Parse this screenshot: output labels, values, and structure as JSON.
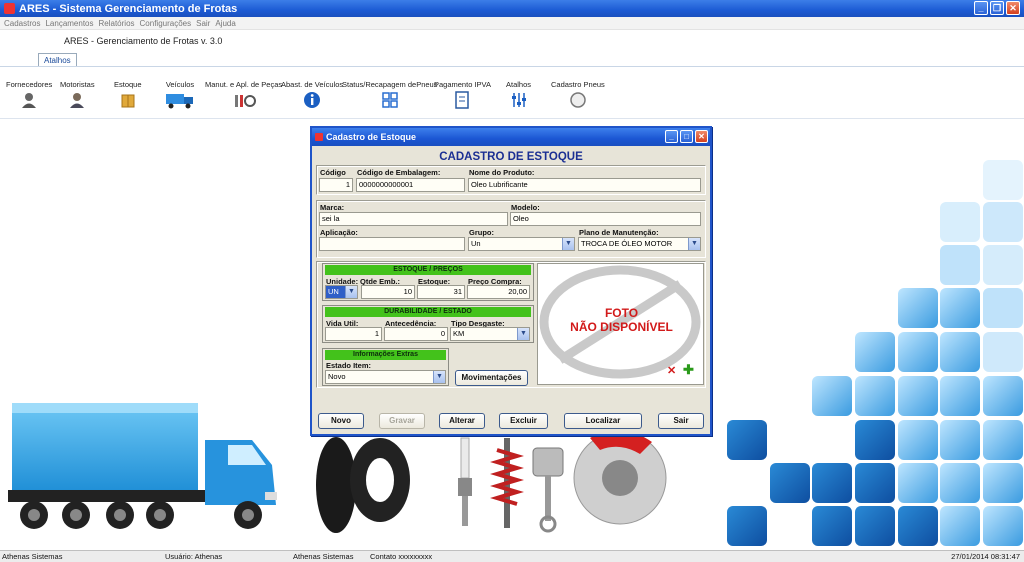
{
  "window": {
    "title": "ARES - Sistema Gerenciamento de Frotas"
  },
  "menu": [
    "Cadastros",
    "Lançamentos",
    "Relatórios",
    "Configurações",
    "Sair",
    "Ajuda"
  ],
  "version": "ARES - Gerenciamento de Frotas v. 3.0",
  "tab": "Atalhos",
  "shortcuts": [
    {
      "label": "Fornecedores",
      "icon": "person-icon"
    },
    {
      "label": "Motoristas",
      "icon": "driver-icon"
    },
    {
      "label": "Estoque",
      "icon": "box-icon"
    },
    {
      "label": "Veículos",
      "icon": "truck-icon"
    },
    {
      "label": "Manut. e Apl. de Peças",
      "icon": "tools-icon"
    },
    {
      "label": "Abast. de Veículos",
      "icon": "info-icon"
    },
    {
      "label": "Status/Recapagem dePneus",
      "icon": "grid-icon"
    },
    {
      "label": "Pagamento IPVA",
      "icon": "document-icon"
    },
    {
      "label": "Atalhos",
      "icon": "sliders-icon"
    },
    {
      "label": "Cadastro Pneus",
      "icon": "circle-icon"
    }
  ],
  "dialog": {
    "title": "Cadastro de Estoque",
    "heading": "CADASTRO DE ESTOQUE",
    "labels": {
      "codigo": "Código",
      "cod_emb": "Código de Embalagem:",
      "nome": "Nome do Produto:",
      "marca": "Marca:",
      "modelo": "Modelo:",
      "aplicacao": "Aplicação:",
      "grupo": "Grupo:",
      "plano": "Plano de Manutenção:",
      "unidade": "Unidade:",
      "qtde": "Qtde Emb.:",
      "estoque": "Estoque:",
      "preco": "Preço Compra:",
      "vida": "Vida Util:",
      "antecedencia": "Antecedência:",
      "tipo": "Tipo Desgaste:",
      "estado": "Estado Item:"
    },
    "values": {
      "codigo": "1",
      "cod_emb": "0000000000001",
      "nome": "Oleo Lubrificante",
      "marca": "sei la",
      "modelo": "Oleo",
      "aplicacao": "",
      "grupo": "Un",
      "plano": "TROCA DE ÓLEO MOTOR",
      "unidade": "UN",
      "qtde": "10",
      "estoque": "31",
      "preco": "20,00",
      "vida": "1",
      "antecedencia": "0",
      "tipo": "KM",
      "estado": "Novo"
    },
    "sections": {
      "estoque": "ESTOQUE / PREÇOS",
      "durabilidade": "DURABILIDADE / ESTADO",
      "info": "Informações Extras"
    },
    "photo": {
      "line1": "FOTO",
      "line2": "NÃO DISPONÍVEL"
    },
    "buttons": {
      "movimentacoes": "Movimentações",
      "novo": "Novo",
      "gravar": "Gravar",
      "alterar": "Alterar",
      "excluir": "Excluir",
      "localizar": "Localizar",
      "sair": "Sair"
    }
  },
  "status": {
    "company": "Athenas Sistemas",
    "user": "Usuário: Athenas",
    "company2": "Athenas Sistemas",
    "contact": "Contato xxxxxxxxx",
    "datetime": "27/01/2014 08:31:47"
  },
  "colors": {
    "title_blue": "#1c5bd4",
    "section_green": "#43c21b",
    "heading_navy": "#1b2f93",
    "photo_red": "#d21a1a"
  }
}
